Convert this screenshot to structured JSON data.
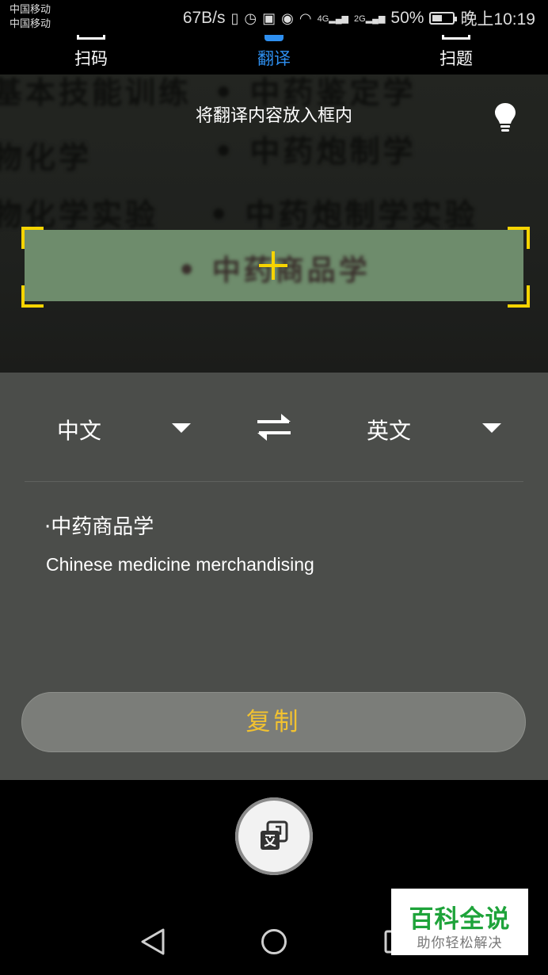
{
  "status_bar": {
    "carrier_1": "中国移动",
    "carrier_2": "中国移动",
    "speed": "67B/s",
    "network_1": "4G",
    "network_2": "2G",
    "battery": "50%",
    "battery_level": 0.5,
    "time": "晚上10:19"
  },
  "mode_tabs": [
    {
      "label": "扫码",
      "active": false
    },
    {
      "label": "翻译",
      "active": true
    },
    {
      "label": "扫题",
      "active": false
    }
  ],
  "viewfinder": {
    "hint": "将翻译内容放入框内",
    "background_lines": [
      "基本技能训练",
      "• 中药鉴定学",
      "物化学",
      "• 中药炮制学",
      "物化学实验",
      "• 中药炮制学实验"
    ],
    "scan_text": "• 中药商品学"
  },
  "translation": {
    "source_language": "中文",
    "target_language": "英文",
    "source_text": "·中药商品学",
    "target_text": "Chinese medicine merchandising",
    "copy_label": "复制"
  },
  "watermark": {
    "title": "百科全说",
    "subtitle": "助你轻松解决"
  },
  "colors": {
    "accent": "#2e8ff0",
    "scan_corner": "#f6d400",
    "copy_text": "#f2c230",
    "panel": "#4b4d4a",
    "watermark_green": "#1ea33a"
  },
  "icons": [
    "lightbulb-icon",
    "swap-icon",
    "translate-icon",
    "crosshair-icon",
    "back-icon",
    "home-icon",
    "recents-icon"
  ]
}
